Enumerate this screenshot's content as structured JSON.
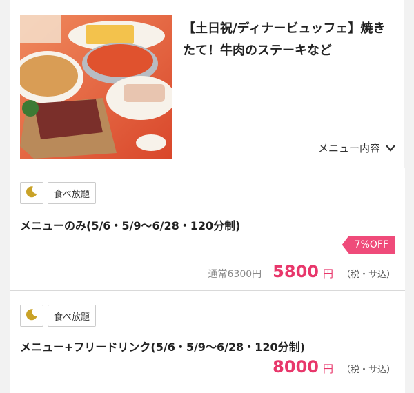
{
  "header": {
    "title": "【土日祝/ディナービュッフェ】焼きたて！牛肉のステーキなど",
    "menu_toggle_label": "メニュー内容"
  },
  "plans": [
    {
      "tag_label": "食べ放題",
      "name": "メニューのみ(5/6・5/9〜6/28・120分制)",
      "discount": "7%OFF",
      "regular_price": "通常6300円",
      "price": "5800",
      "currency": "円",
      "tax_note": "（税・サ込）"
    },
    {
      "tag_label": "食べ放題",
      "name": "メニュー+フリードリンク(5/6・5/9〜6/28・120分制)",
      "price": "8000",
      "currency": "円",
      "tax_note": "（税・サ込）"
    }
  ],
  "icons": {
    "night": "moon-icon",
    "expand": "chevron-down-icon"
  },
  "colors": {
    "accent": "#e8376b",
    "badge": "#ef4b7a",
    "moon": "#c9a227"
  }
}
